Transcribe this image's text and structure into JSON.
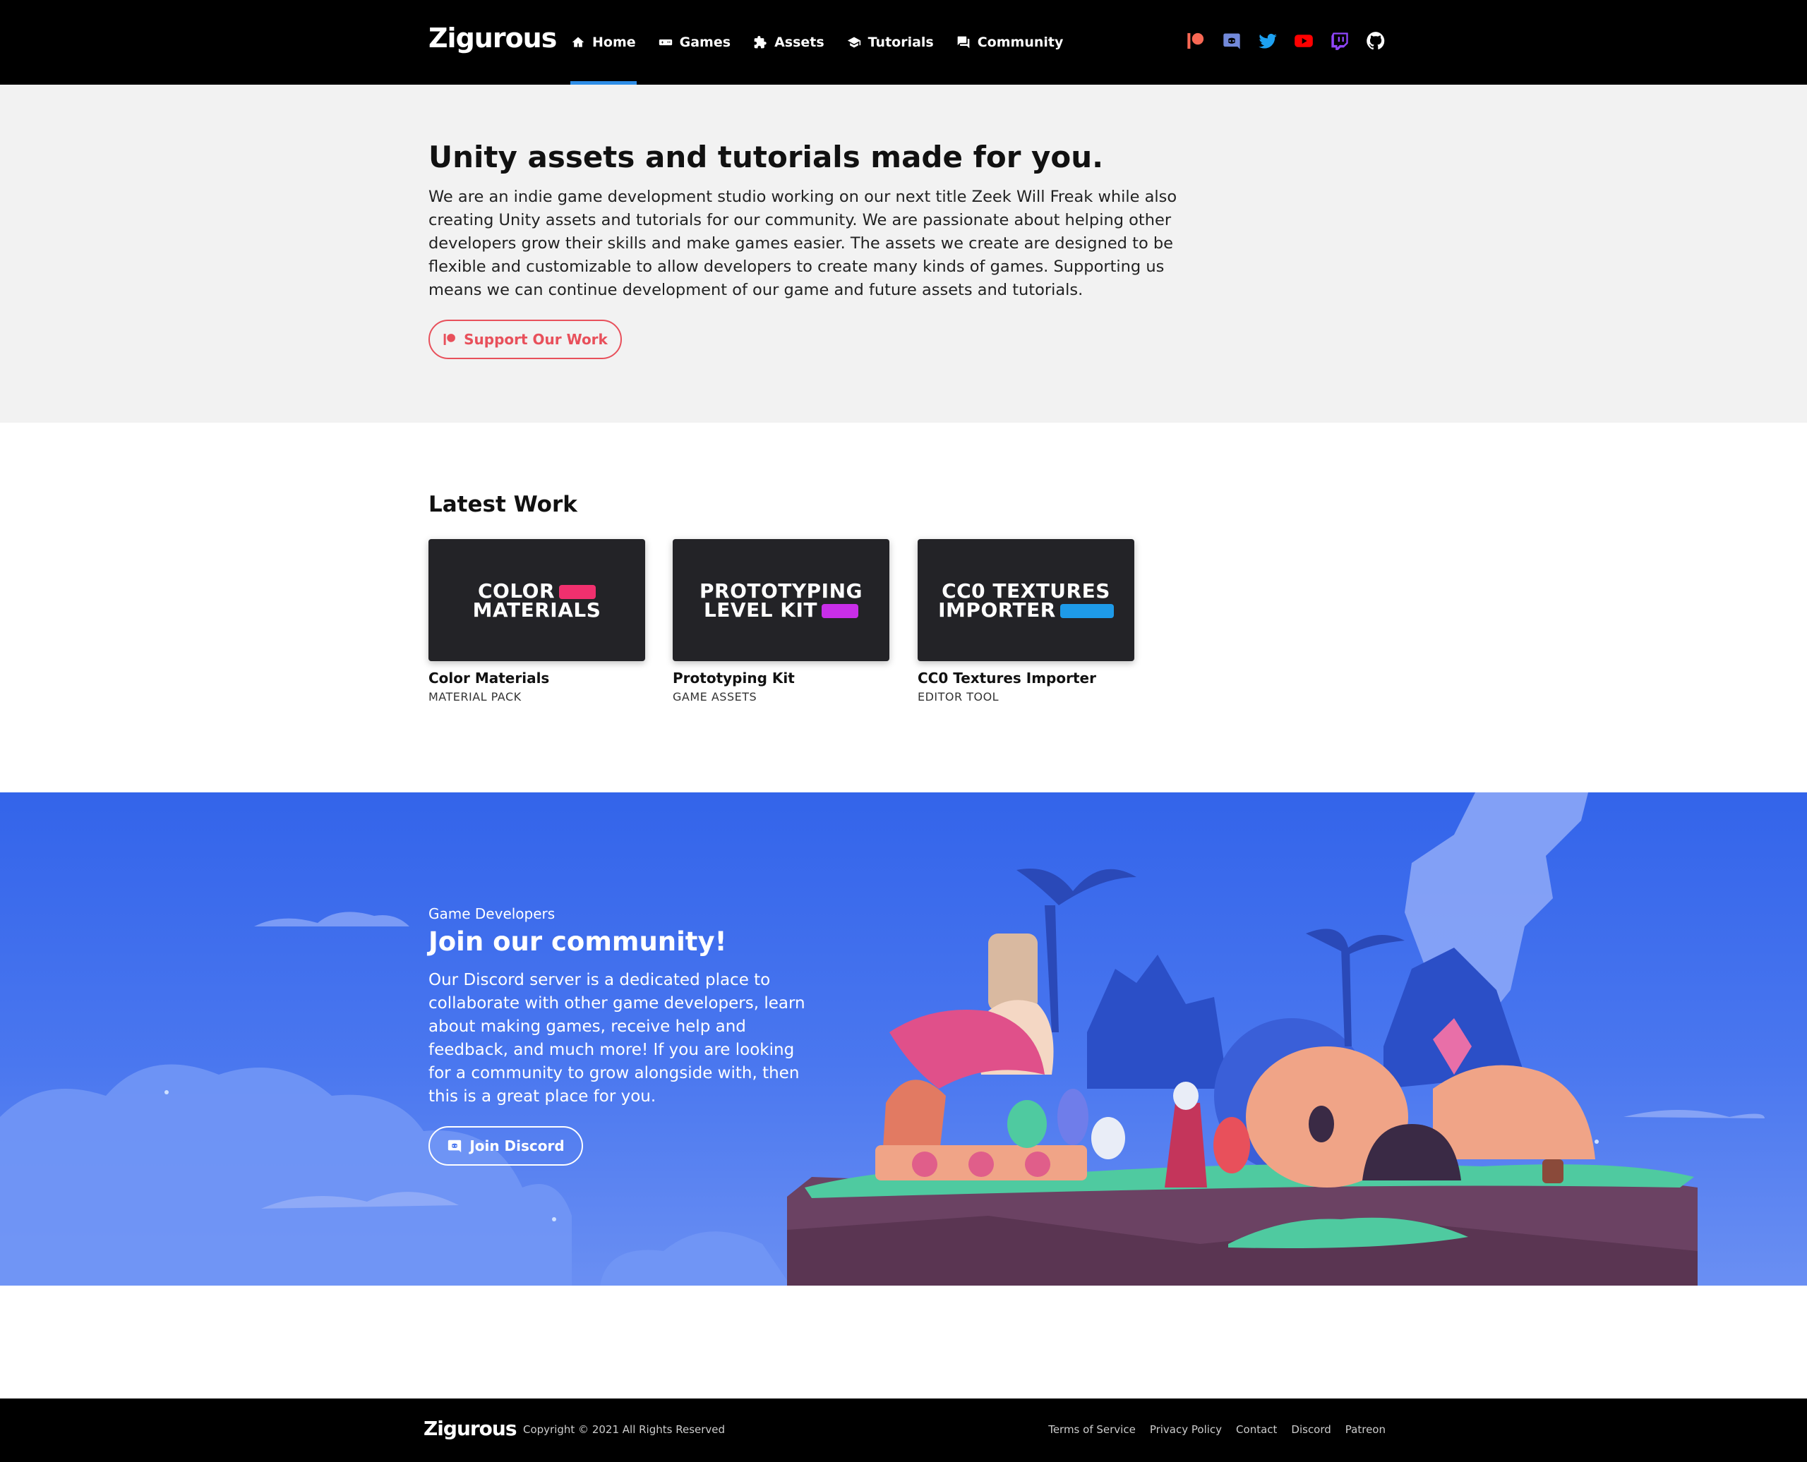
{
  "nav": {
    "brand": "Zigurous",
    "items": [
      {
        "label": "Home",
        "icon": "home-icon"
      },
      {
        "label": "Games",
        "icon": "gamepad-icon"
      },
      {
        "label": "Assets",
        "icon": "puzzle-icon"
      },
      {
        "label": "Tutorials",
        "icon": "graduation-cap-icon"
      },
      {
        "label": "Community",
        "icon": "chat-icon"
      }
    ],
    "active_item": "Home",
    "socials": [
      {
        "name": "patreon-icon",
        "color": "#f96854"
      },
      {
        "name": "discord-icon",
        "color": "#7289da"
      },
      {
        "name": "twitter-icon",
        "color": "#1da1f2"
      },
      {
        "name": "youtube-icon",
        "color": "#ff0000"
      },
      {
        "name": "twitch-icon",
        "color": "#9146ff"
      },
      {
        "name": "github-icon",
        "color": "#ffffff"
      }
    ]
  },
  "hero": {
    "title": "Unity assets and tutorials made for you.",
    "body": "We are an indie game development studio working on our next title Zeek Will Freak while also creating Unity assets and tutorials for our community. We are passionate about helping other developers grow their skills and make games easier. The assets we create are designed to be flexible and customizable to allow developers to create many kinds of games. Supporting us means we can continue development of our game and future assets and tutorials.",
    "button_label": "Support Our Work",
    "accent": "#e8505b"
  },
  "latest": {
    "title": "Latest Work",
    "cards": [
      {
        "thumb_line1": "COLOR",
        "thumb_line2": "MATERIALS",
        "chip_color": "#f0306e",
        "name": "Color Materials",
        "type": "MATERIAL PACK"
      },
      {
        "thumb_line1": "PROTOTYPING",
        "thumb_line2": "LEVEL KIT",
        "chip_color": "#c82ee8",
        "name": "Prototyping Kit",
        "type": "GAME ASSETS"
      },
      {
        "thumb_line1": "CC0 TEXTURES",
        "thumb_line2": "IMPORTER",
        "chip_color": "#1e9ae8",
        "name": "CC0 Textures Importer",
        "type": "EDITOR TOOL"
      }
    ]
  },
  "community": {
    "eyebrow": "Game Developers",
    "title": "Join our community!",
    "body": "Our Discord server is a dedicated place to collaborate with other game developers, learn about making games, receive help and feedback, and much more! If you are looking for a community to grow alongside with, then this is a great place for you.",
    "button_label": "Join Discord",
    "background": "#3f6cec"
  },
  "footer": {
    "brand": "Zigurous",
    "copyright": "Copyright © 2021 All Rights Reserved",
    "links": [
      "Terms of Service",
      "Privacy Policy",
      "Contact",
      "Discord",
      "Patreon"
    ]
  }
}
